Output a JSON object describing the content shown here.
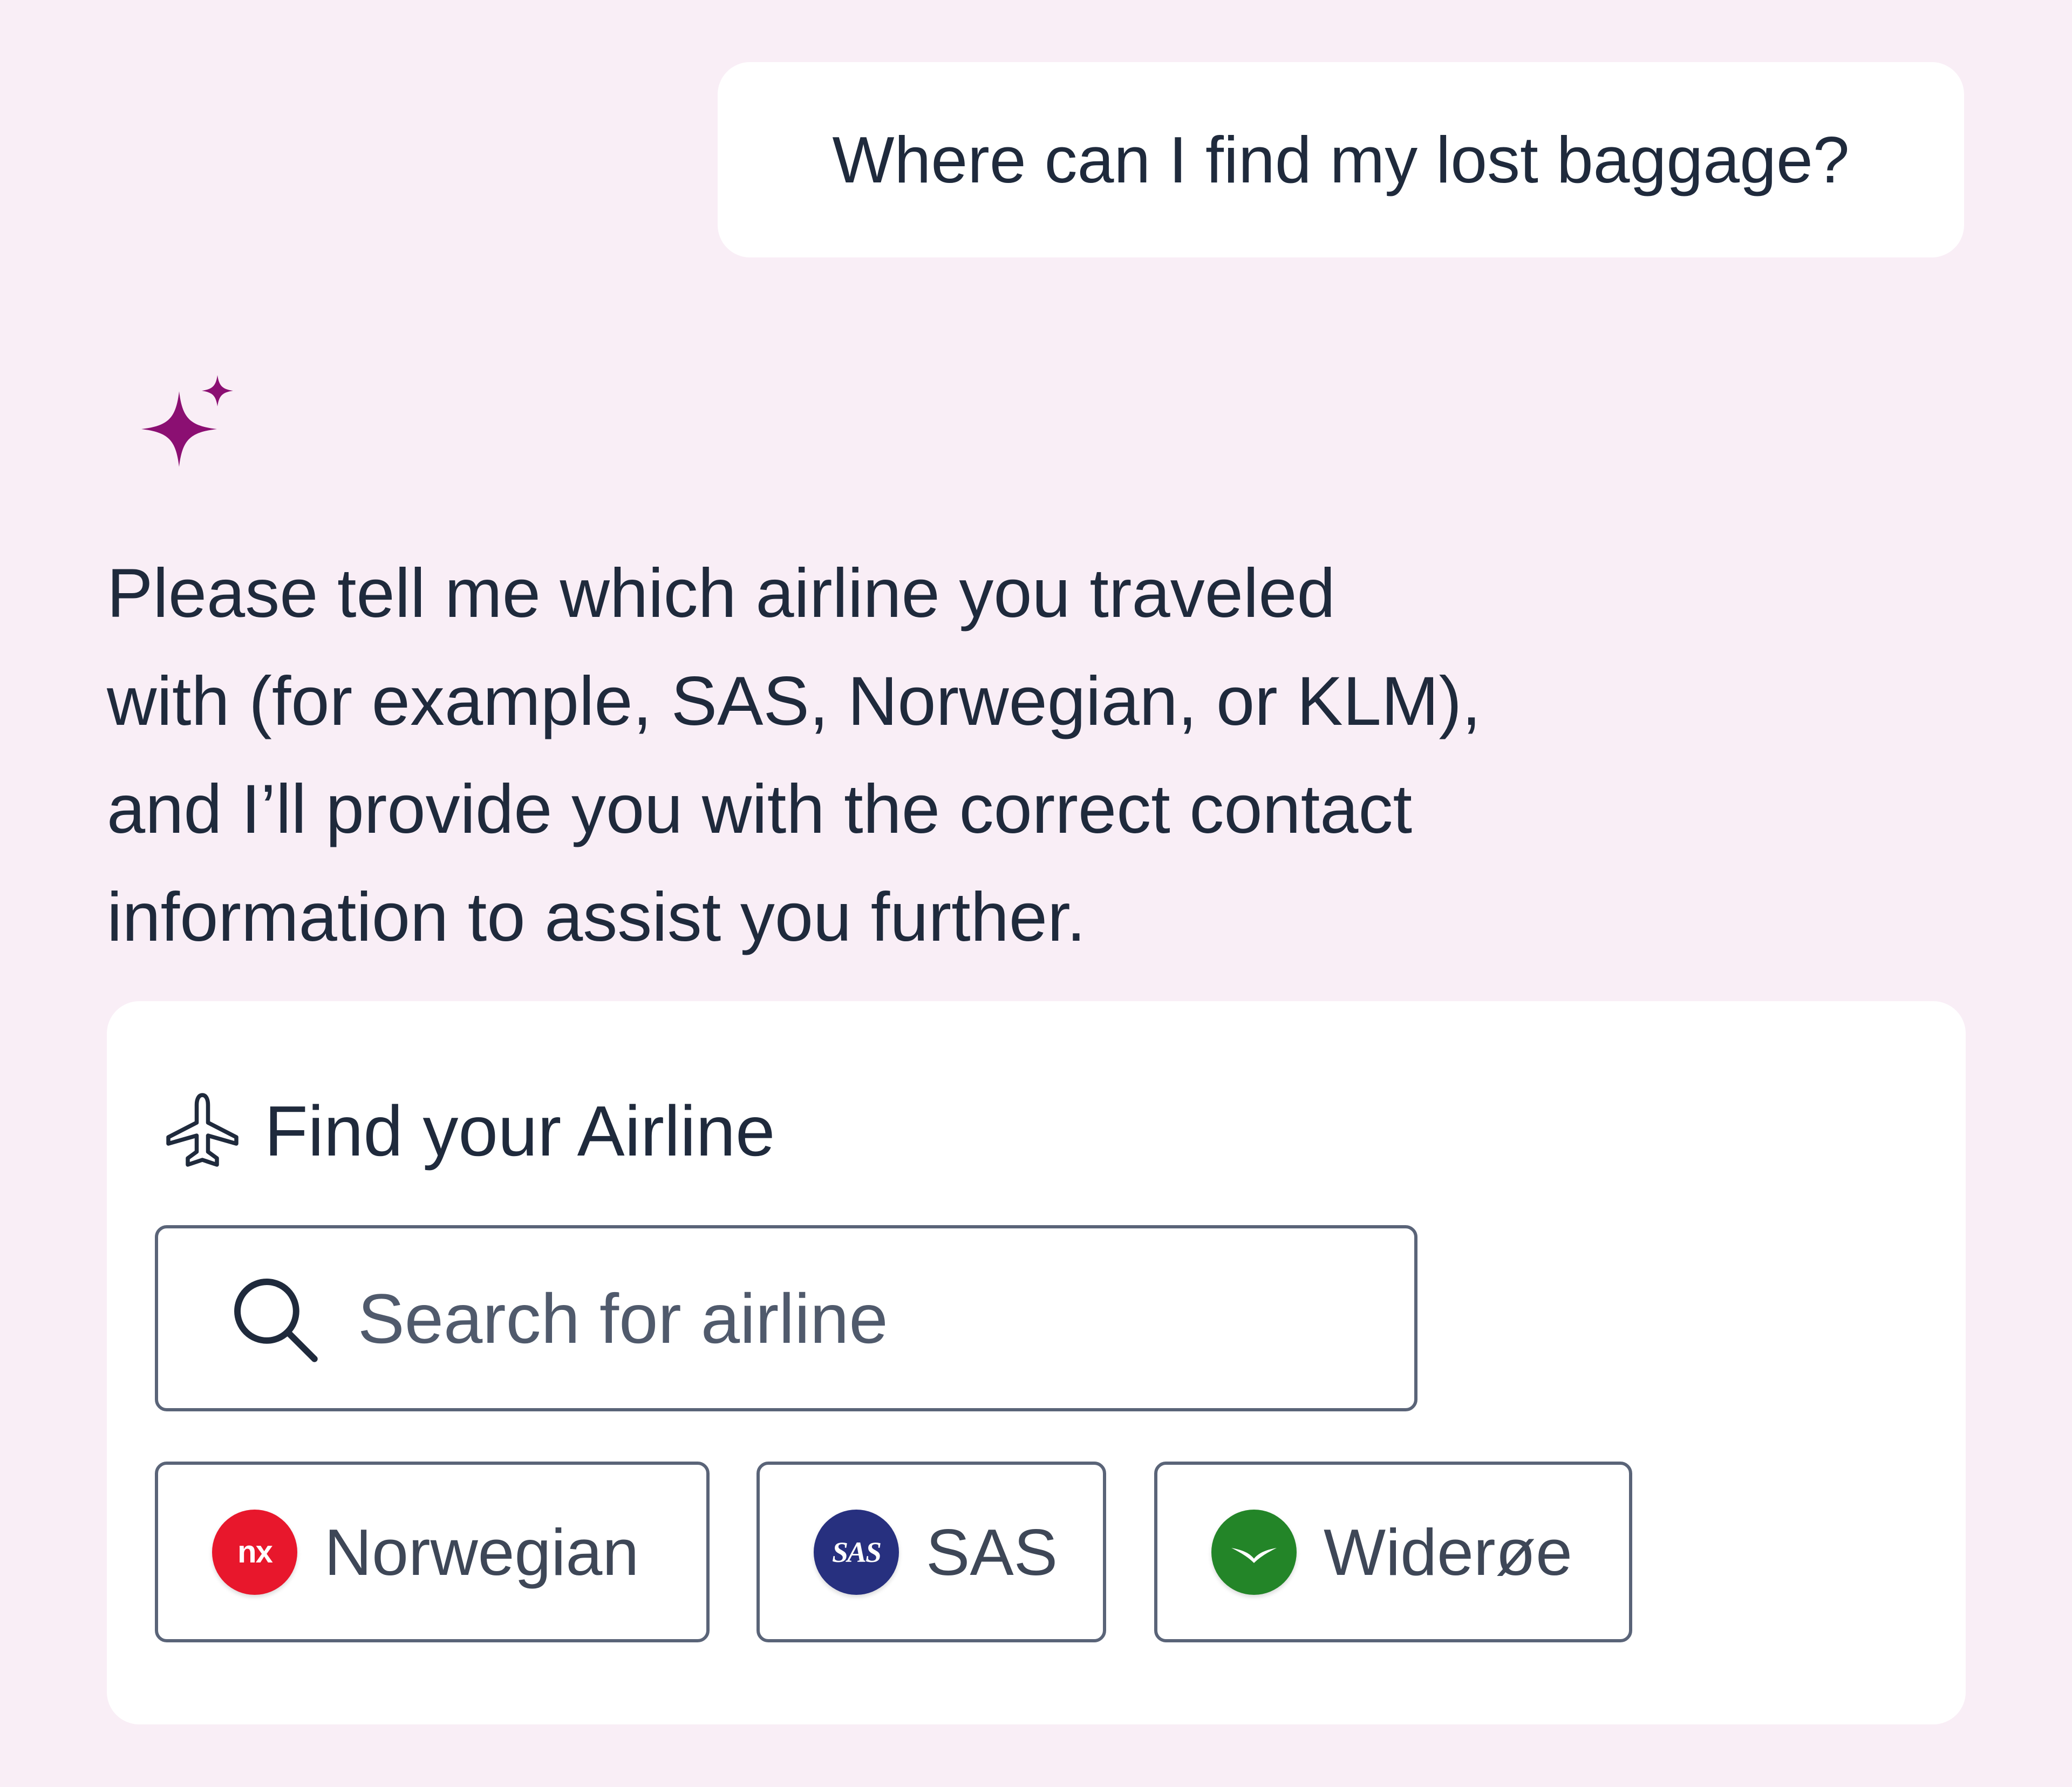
{
  "user_message": {
    "text": "Where can I find my lost baggage?"
  },
  "assistant": {
    "icon": "sparkle-icon",
    "accent_color": "#8b0f72",
    "message_lines": [
      "Please tell me which airline you traveled",
      "with (for example, SAS, Norwegian, or KLM),",
      "and I’ll provide you with the correct contact",
      "information to assist you further."
    ]
  },
  "airline_finder": {
    "title": "Find your Airline",
    "icon": "airplane-icon",
    "search": {
      "placeholder": "Search for airline",
      "value": "",
      "icon": "search-icon"
    },
    "airlines": [
      {
        "label": "Norwegian",
        "logo_text": "nx",
        "logo_color": "#e8172c"
      },
      {
        "label": "SAS",
        "logo_text": "SAS",
        "logo_color": "#27307f"
      },
      {
        "label": "Widerøe",
        "logo_text": "",
        "logo_color": "#238528"
      }
    ]
  }
}
